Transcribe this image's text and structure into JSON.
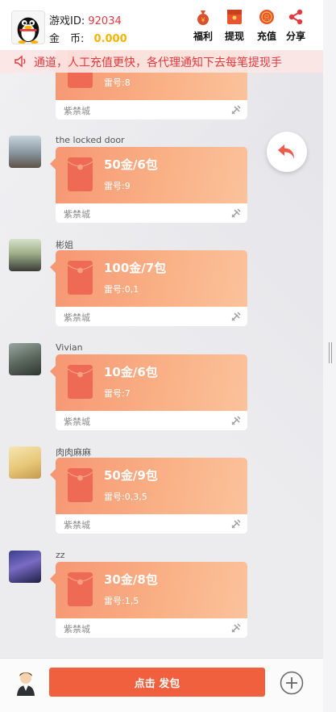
{
  "header": {
    "id_label": "游戏ID:",
    "id_value": "92034",
    "coin_label": "金　币:",
    "coin_value": "0.000",
    "buttons": [
      {
        "label": "福利",
        "icon": "money-bag-icon"
      },
      {
        "label": "提现",
        "icon": "withdraw-envelope-icon"
      },
      {
        "label": "充值",
        "icon": "recharge-icon"
      },
      {
        "label": "分享",
        "icon": "share-icon"
      }
    ]
  },
  "notice": {
    "text": "通道，人工充值更快，各代理通知下去每笔提现手"
  },
  "partial_message": {
    "leino": "雷号:8",
    "city": "紫禁城"
  },
  "messages": [
    {
      "name": "the locked door",
      "amount": "50金/6包",
      "leino": "雷号:9",
      "city": "紫禁城"
    },
    {
      "name": "彬姐",
      "amount": "100金/7包",
      "leino": "雷号:0,1",
      "city": "紫禁城"
    },
    {
      "name": "Vivian",
      "amount": "10金/6包",
      "leino": "雷号:7",
      "city": "紫禁城"
    },
    {
      "name": "肉肉麻麻",
      "amount": "50金/9包",
      "leino": "雷号:0,3,5",
      "city": "紫禁城"
    },
    {
      "name": "zz",
      "amount": "30金/8包",
      "leino": "雷号:1,5",
      "city": "紫禁城"
    }
  ],
  "footer": {
    "send_label": "点击 发包"
  },
  "colors": {
    "accent": "#f1603e",
    "card_gradient_start": "#f69773",
    "id_red": "#e0393e",
    "coin_gold": "#f5b400"
  }
}
